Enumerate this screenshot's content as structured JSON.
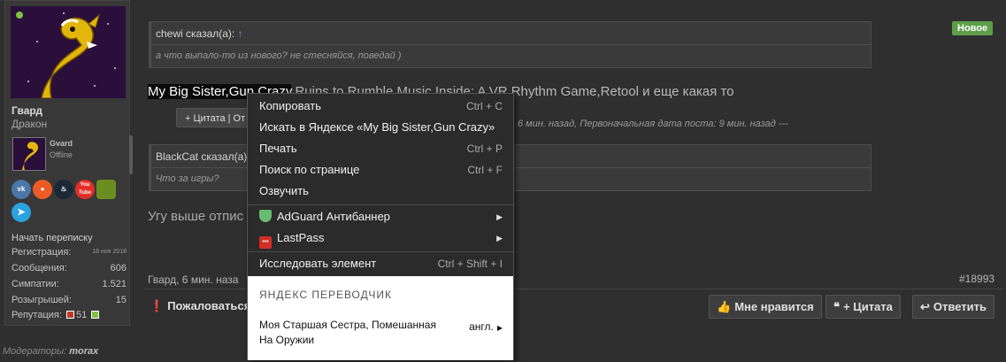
{
  "user": {
    "name": "Гвард",
    "title": "Дракон",
    "mini_name": "Gvard",
    "mini_status": "Offline",
    "start_conversation": "Начать переписку",
    "stats": [
      {
        "label": "Регистрация:",
        "value": "18 ноя 2018"
      },
      {
        "label": "Сообщения:",
        "value": "606"
      },
      {
        "label": "Симпатии:",
        "value": "1.521"
      },
      {
        "label": "Розыгрышей:",
        "value": "15"
      },
      {
        "label": "Репутация:",
        "value": "51"
      }
    ],
    "socials": [
      {
        "icon": "vk-icon",
        "text": "vk",
        "color": "#4a76a8"
      },
      {
        "icon": "ok-icon",
        "text": "ok",
        "color": "#ee5a24"
      },
      {
        "icon": "steam-icon",
        "text": "st",
        "color": "#1b2838"
      },
      {
        "icon": "youtube-icon",
        "text": "You Tube",
        "color": "#e52d27"
      },
      {
        "icon": "minecraft-icon",
        "text": "",
        "color": "#6b8e23"
      },
      {
        "icon": "telegram-icon",
        "text": "",
        "color": "#2aa3e0"
      }
    ]
  },
  "post": {
    "quote1_author": "chewi сказал(а):",
    "quote1_text": "а что выпало-то из нового? не стесняйся, поведай )",
    "new_badge": "Новое",
    "text_selected": "My Big Sister,Gun Crazy",
    "text_rest": ",Ruins to Rumble,Music Inside: A VR Rhythm Game,Retool и еще какая то",
    "quote_button": "+ Цитата | От",
    "edited_note": "6 мин. назад, Первоначальная дата поста: 9 мин. назад ---",
    "quote2_author": "BlackCat сказал(а):",
    "quote2_text": "Что за игры?",
    "reply_text": "Угу выше отпис",
    "meta": "Гвард, 6 мин. наза",
    "number": "#18993"
  },
  "actions": {
    "report": "Пожаловаться",
    "like": "Мне нравится",
    "quote": "+ Цитата",
    "reply": "Ответить"
  },
  "moderators": {
    "label": "Модераторы:",
    "name": "morax"
  },
  "context_menu": {
    "items": [
      {
        "label": "Копировать",
        "shortcut": "Ctrl + C"
      },
      {
        "label": "Искать в Яндексе «My Big Sister,Gun Crazy»",
        "shortcut": ""
      },
      {
        "label": "Печать",
        "shortcut": "Ctrl + P"
      },
      {
        "label": "Поиск по странице",
        "shortcut": "Ctrl + F"
      },
      {
        "label": "Озвучить",
        "shortcut": ""
      },
      {
        "label": "AdGuard Антибаннер",
        "shortcut": ""
      },
      {
        "label": "LastPass",
        "shortcut": ""
      },
      {
        "label": "Исследовать элемент",
        "shortcut": "Ctrl + Shift + I"
      }
    ],
    "translator": {
      "header": "ЯНДЕКС ПЕРЕВОДЧИК",
      "translation": "Моя Старшая Сестра, Помешанная На Оружии",
      "language": "англ."
    }
  },
  "colors": {
    "accent_green": "#5e9e4a",
    "link_blue": "#5b9bd5",
    "reputation_red": "#c0392b",
    "reputation_green": "#7fc241"
  }
}
